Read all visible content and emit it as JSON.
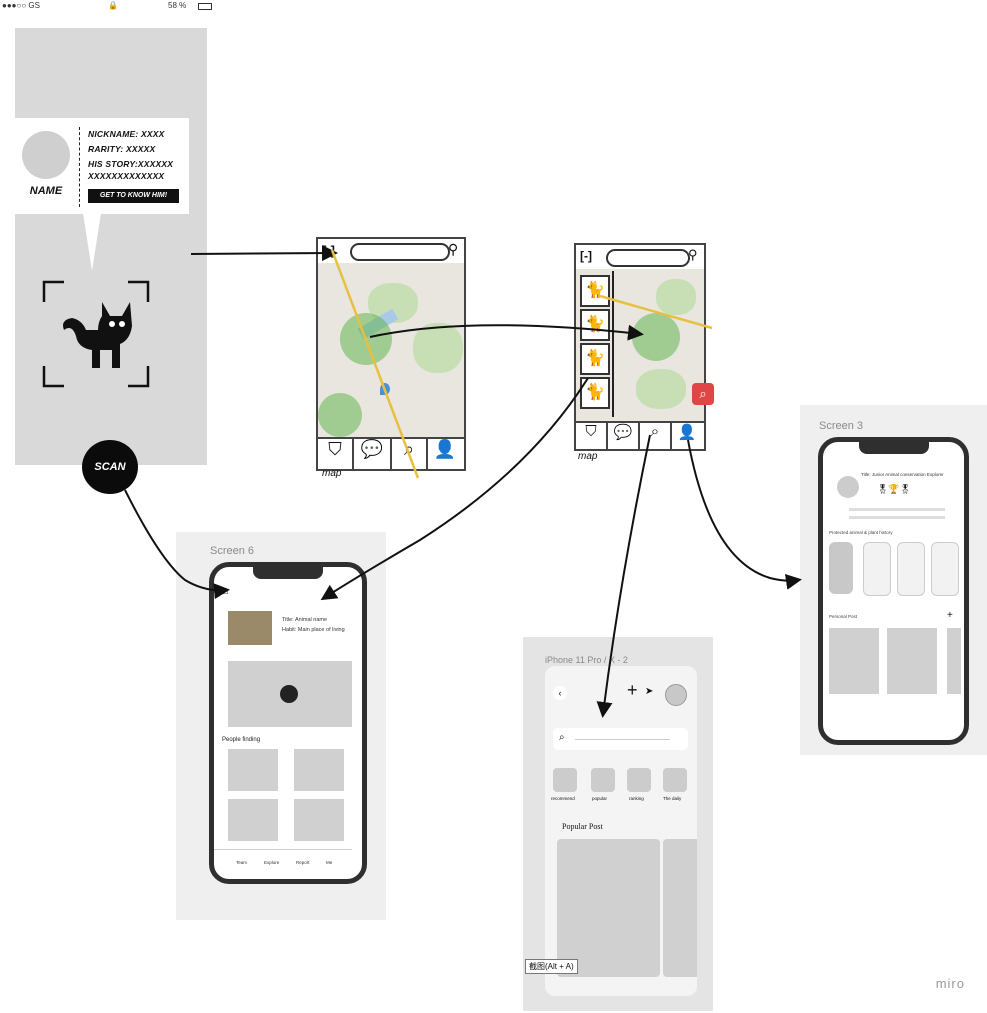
{
  "status_bar": {
    "carrier": "●●●○○ GS",
    "battery": "58 %"
  },
  "info_card": {
    "avatar_label": "NAME",
    "lines": [
      "NICKNAME: XXXX",
      "RARITY: XXXXX",
      "HIS STORY:XXXXXX",
      "XXXXXXXXXXXXX"
    ],
    "cta": "GET TO KNOW HIM!",
    "scan_label": "SCAN"
  },
  "sketch_map_1": {
    "caption": "map"
  },
  "sketch_map_2": {
    "caption": "map"
  },
  "screen6": {
    "frame_label": "Screen 6",
    "title_line": "Title:  Animal name",
    "habit_line": "Habit: Main place of living",
    "section_label": "People finding",
    "nav": [
      "Team",
      "Explore",
      "Report",
      "Me"
    ]
  },
  "iphone_frame": {
    "frame_label": "iPhone 11 Pro / X - 2",
    "categories": [
      "recommend",
      "popular",
      "ranking",
      "The daily"
    ],
    "section_title": "Popular Post",
    "tooltip": "截图(Alt + A)"
  },
  "screen3": {
    "frame_label": "Screen 3",
    "title_line": "Title: Junior Animal conservation Explorer",
    "history_label": "Protected animal & plant history",
    "post_label": "Personal Post",
    "add_symbol": "+"
  },
  "watermark": "miro",
  "colors": {
    "zone_green": "#64b450",
    "alert_red": "#e04646",
    "road_yellow": "#e8c040"
  }
}
